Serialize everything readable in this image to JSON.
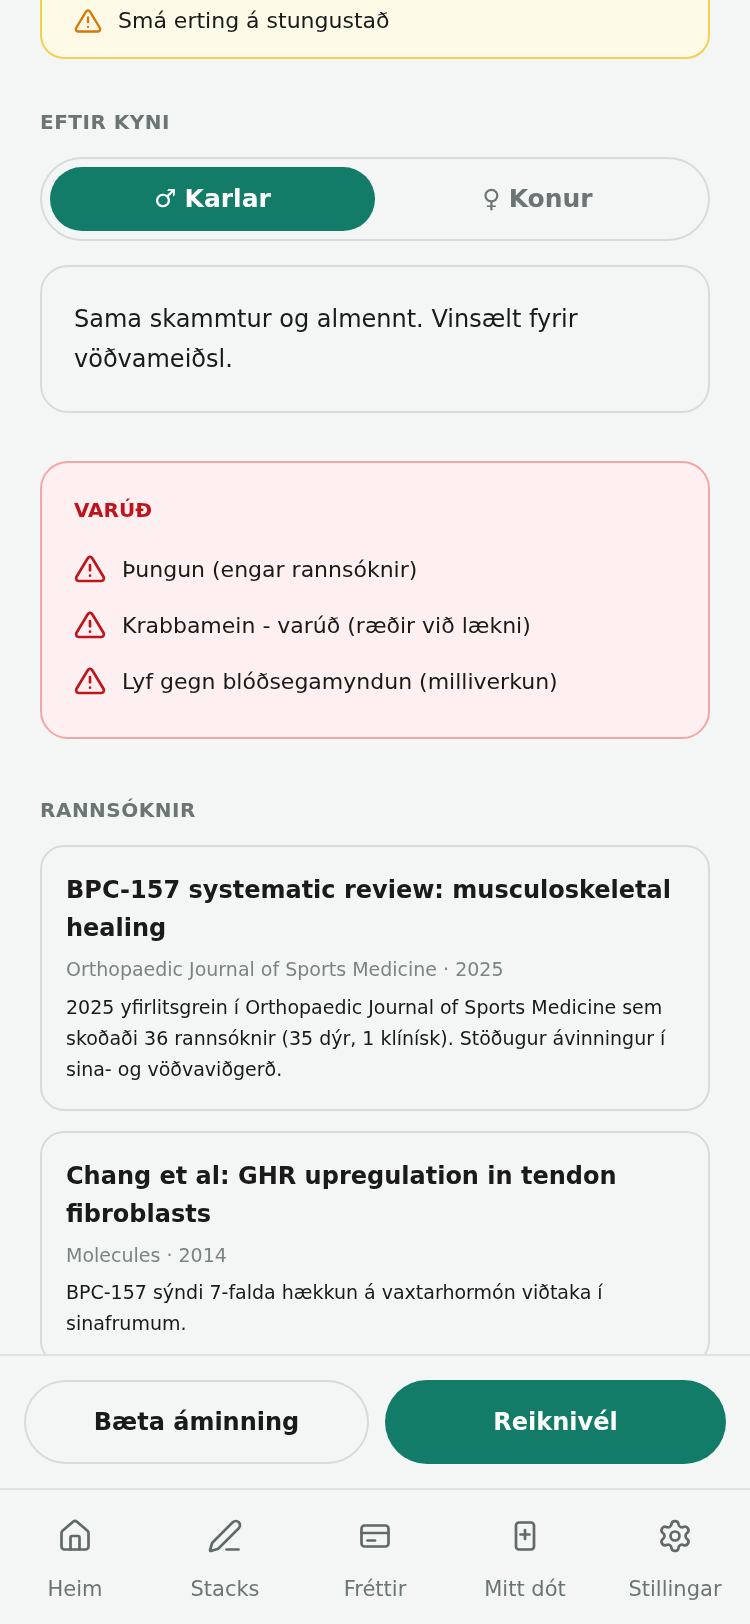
{
  "side_effect_note": {
    "text": "Smá erting á stungustað"
  },
  "sex_section": {
    "heading": "EFTIR KYNI",
    "options": [
      {
        "symbol": "♂",
        "label": "Karlar",
        "selected": true
      },
      {
        "symbol": "♀",
        "label": "Konur",
        "selected": false
      }
    ],
    "note": "Sama skammtur og almennt. Vinsælt fyrir vöðvameiðsl."
  },
  "caution": {
    "heading": "VARÚÐ",
    "items": [
      "Þungun (engar rannsóknir)",
      "Krabbamein - varúð (ræðir við lækni)",
      "Lyf gegn blóðsegamyndun (milliverkun)"
    ]
  },
  "research": {
    "heading": "RANNSÓKNIR",
    "studies": [
      {
        "title": "BPC-157 systematic review: musculoskeletal healing",
        "source": "Orthopaedic Journal of Sports Medicine · 2025",
        "summary": "2025 yfirlitsgrein í Orthopaedic Journal of Sports Medicine sem skoðaði 36 rannsóknir (35 dýr, 1 klínísk). Stöðugur ávinningur í sina- og vöðvaviðgerð."
      },
      {
        "title": "Chang et al: GHR upregulation in tendon fibroblasts",
        "source": "Molecules · 2014",
        "summary": "BPC-157 sýndi 7-falda hækkun á vaxtarhormón viðtaka í sinafrumum."
      }
    ]
  },
  "actions": [
    {
      "kind": "secondary",
      "label": "Bæta áminning"
    },
    {
      "kind": "primary",
      "label": "Reiknivél"
    }
  ],
  "nav": [
    {
      "kind": "home",
      "label": "Heim"
    },
    {
      "kind": "pen",
      "label": "Stacks"
    },
    {
      "kind": "card",
      "label": "Fréttir"
    },
    {
      "kind": "doc-plus",
      "label": "Mitt dót"
    },
    {
      "kind": "gear",
      "label": "Stillingar"
    }
  ]
}
